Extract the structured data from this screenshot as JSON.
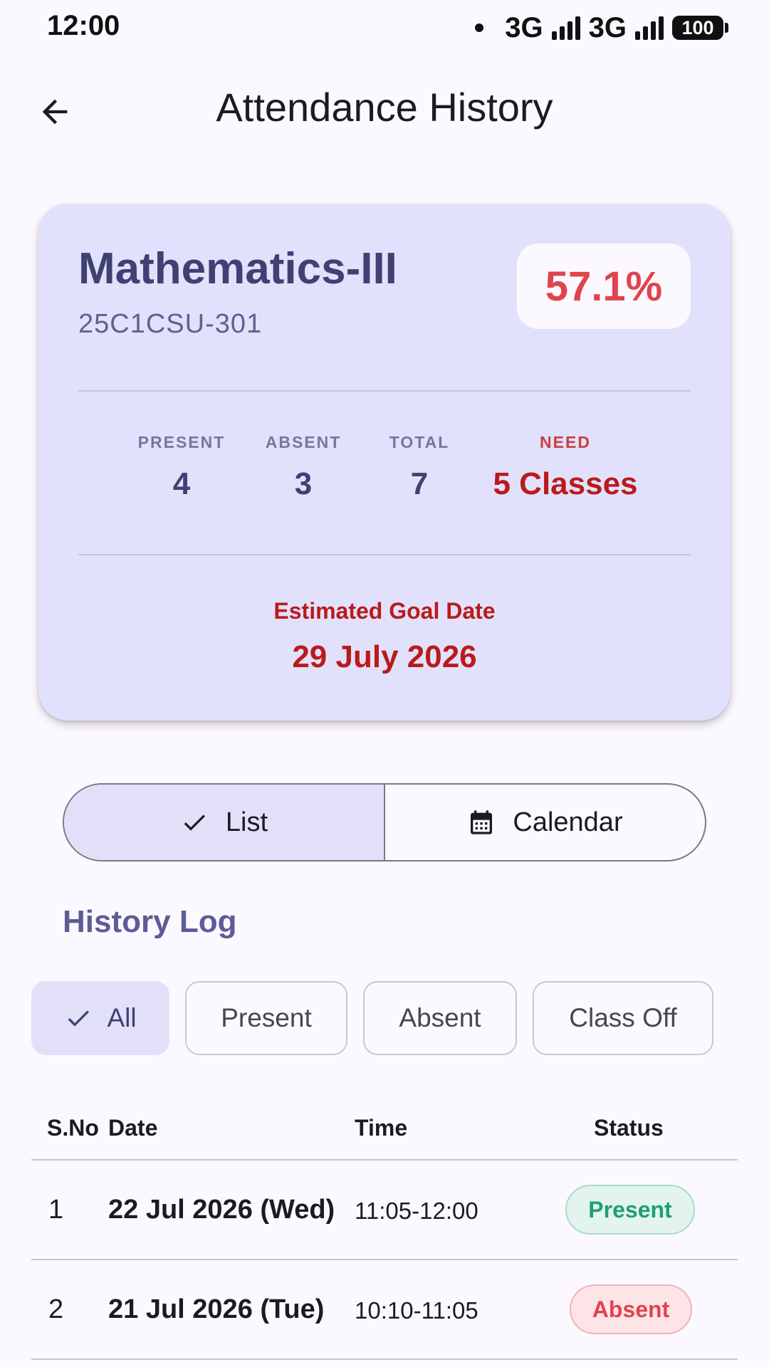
{
  "status_bar": {
    "time": "12:00",
    "network1": "3G",
    "network2": "3G",
    "battery": "100"
  },
  "app_bar": {
    "title": "Attendance History"
  },
  "summary": {
    "subject": "Mathematics-III",
    "code": "25C1CSU-301",
    "percentage": "57.1%",
    "stats": {
      "present_label": "PRESENT",
      "present_value": "4",
      "absent_label": "ABSENT",
      "absent_value": "3",
      "total_label": "TOTAL",
      "total_value": "7",
      "need_label": "NEED",
      "need_value": "5 Classes"
    },
    "goal_label": "Estimated Goal Date",
    "goal_date": "29 July 2026",
    "colors": {
      "card_bg": "#e2e1fc",
      "percent": "#e0444d",
      "need": "#ba1a1a"
    }
  },
  "view_toggle": {
    "list_label": "List",
    "calendar_label": "Calendar",
    "selected": "List"
  },
  "history": {
    "title": "History Log",
    "filters": [
      "All",
      "Present",
      "Absent",
      "Class Off"
    ],
    "selected_filter": "All",
    "columns": [
      "S.No",
      "Date",
      "Time",
      "Status"
    ],
    "rows": [
      {
        "sno": "1",
        "date": "22 Jul 2026 (Wed)",
        "time": "11:05-12:00",
        "status": "Present"
      },
      {
        "sno": "2",
        "date": "21 Jul 2026 (Tue)",
        "time": "10:10-11:05",
        "status": "Absent"
      }
    ]
  }
}
